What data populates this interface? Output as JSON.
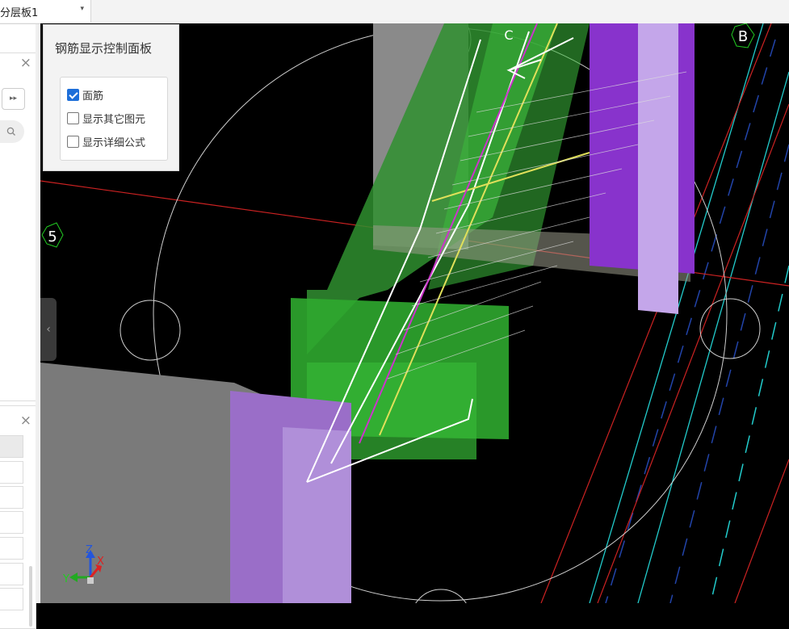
{
  "toolbar": {
    "layer_dropdown_value": "分层板1"
  },
  "left_panel": {},
  "control_panel": {
    "title": "钢筋显示控制面板",
    "options": [
      {
        "label": "面筋",
        "checked": true
      },
      {
        "label": "显示其它图元",
        "checked": false
      },
      {
        "label": "显示详细公式",
        "checked": false
      }
    ]
  },
  "viewport": {
    "axis_labels": {
      "five": "5",
      "b": "B",
      "c": "C"
    },
    "gizmo": {
      "x": "X",
      "y": "Y",
      "z": "Z"
    }
  },
  "colors": {
    "rebar": "#ffffff",
    "beam_green": "#2fa82f",
    "column_purple": "#9966cc",
    "axis_red": "#cc2222",
    "axis_cyan": "#22cccc"
  }
}
